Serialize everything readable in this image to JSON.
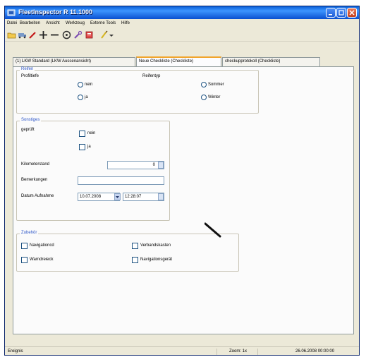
{
  "window": {
    "title": "FleetInspector R 11.1000"
  },
  "menu": [
    "Datei",
    "Bearbeiten",
    "Ansicht",
    "Werkzeug",
    "Externe Tools",
    "Hilfe"
  ],
  "toolbar": {
    "icons": [
      "folder-icon",
      "vehicle-icon",
      "pen-icon",
      "add-icon",
      "remove-icon",
      "target-icon",
      "tool-icon",
      "report-icon",
      "brush-icon",
      "dropdown-arrow-icon"
    ]
  },
  "tabs": [
    "(1) LKW Standard (LKW Aussenansicht)",
    "Neue Checkliste (Checkliste)",
    "checkupprotokoll (Checkliste)"
  ],
  "active_tab": 1,
  "reifen": {
    "title": "Reifen",
    "profiltiefe_label": "Profiltiefe",
    "profiltiefe_options": [
      "nein",
      "ja"
    ],
    "reifentyp_label": "Reifentyp",
    "reifentyp_options": [
      "Sommer",
      "Winter"
    ]
  },
  "sonstiges": {
    "title": "Sonstiges",
    "geprueft_label": "geprüft",
    "geprueft_options": [
      "nein",
      "ja"
    ],
    "kilometerstand_label": "Kilometerstand",
    "kilometerstand_value": "0",
    "bemerkungen_label": "Bemerkungen",
    "bemerkungen_value": "",
    "datum_label": "Datum Aufnahme",
    "datum_value": "10.07.2008",
    "zeit_value": "12:28:07"
  },
  "zubehoer": {
    "title": "Zubehör",
    "items": [
      "Navigationcd",
      "Verbandskasten",
      "Warndreieck",
      "Navigationsgerät"
    ]
  },
  "status": {
    "left": "Ereignis",
    "zoom": "Zoom: 1x",
    "datetime": "26.06.2008 00:00:00"
  }
}
